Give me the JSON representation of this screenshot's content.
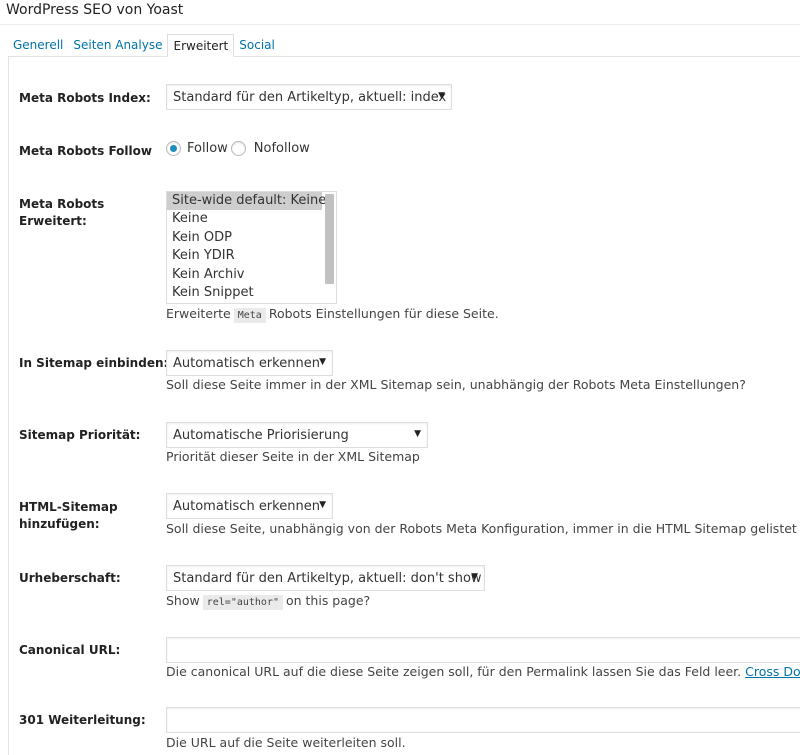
{
  "header": {
    "title": "WordPress SEO von Yoast"
  },
  "tabs": [
    {
      "label": "Generell"
    },
    {
      "label": "Seiten Analyse"
    },
    {
      "label": "Erweitert"
    },
    {
      "label": "Social"
    }
  ],
  "fields": {
    "meta_robots_index": {
      "label": "Meta Robots Index:",
      "value": "Standard für den Artikeltyp, aktuell: index"
    },
    "meta_robots_follow": {
      "label": "Meta Robots Follow",
      "options": [
        "Follow",
        "Nofollow"
      ],
      "selected": "Follow"
    },
    "meta_robots_advanced": {
      "label_line1": "Meta Robots",
      "label_line2": "Erweitert:",
      "options": [
        "Site-wide default: Keine",
        "Keine",
        "Kein ODP",
        "Kein YDIR",
        "Kein Archiv",
        "Kein Snippet"
      ],
      "selected": "Site-wide default: Keine",
      "desc_before": "Erweiterte",
      "desc_code": "Meta",
      "desc_after": "Robots Einstellungen für diese Seite."
    },
    "sitemap_include": {
      "label": "In Sitemap einbinden:",
      "value": "Automatisch erkennen",
      "desc": "Soll diese Seite immer in der XML Sitemap sein, unabhängig der Robots Meta Einstellungen?"
    },
    "sitemap_priority": {
      "label": "Sitemap Priorität:",
      "value": "Automatische Priorisierung",
      "desc": "Priorität dieser Seite in der XML Sitemap"
    },
    "html_sitemap": {
      "label_line1": "HTML-Sitemap",
      "label_line2": "hinzufügen:",
      "value": "Automatisch erkennen",
      "desc": "Soll diese Seite, unabhängig von der Robots Meta Konfiguration, immer in die HTML Sitemap gelistet se"
    },
    "authorship": {
      "label": "Urheberschaft:",
      "value": "Standard für den Artikeltyp, aktuell: don't show",
      "desc_before": "Show",
      "desc_code": "rel=\"author\"",
      "desc_after": "on this page?"
    },
    "canonical_url": {
      "label": "Canonical URL:",
      "value": "",
      "desc": "Die canonical URL auf die diese Seite zeigen soll, für den Permalink lassen Sie das Feld leer.",
      "link": "Cross Dom"
    },
    "redirect_301": {
      "label": "301 Weiterleitung:",
      "value": "",
      "desc": "Die URL auf die Seite weiterleiten soll."
    }
  },
  "icons": {
    "dropdown": "chevron-down-icon"
  },
  "colors": {
    "link": "#0073aa",
    "radio_selected": "#1e8cbe",
    "list_selected": "#cecece"
  }
}
